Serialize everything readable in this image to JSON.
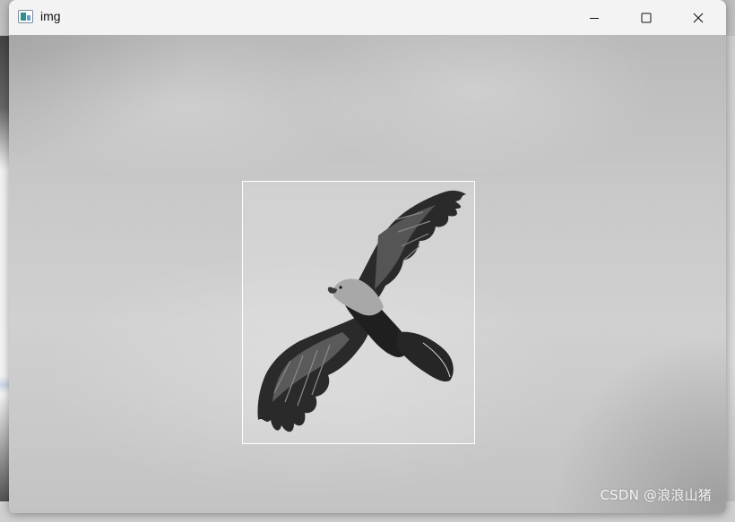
{
  "window": {
    "title": "img",
    "icon": "opencv-window-icon",
    "controls": [
      "minimize-icon",
      "maximize-icon",
      "close-icon"
    ]
  },
  "image": {
    "subject": "eagle",
    "bbox_color": "#ffffff"
  },
  "watermark": "CSDN @浪浪山猪"
}
